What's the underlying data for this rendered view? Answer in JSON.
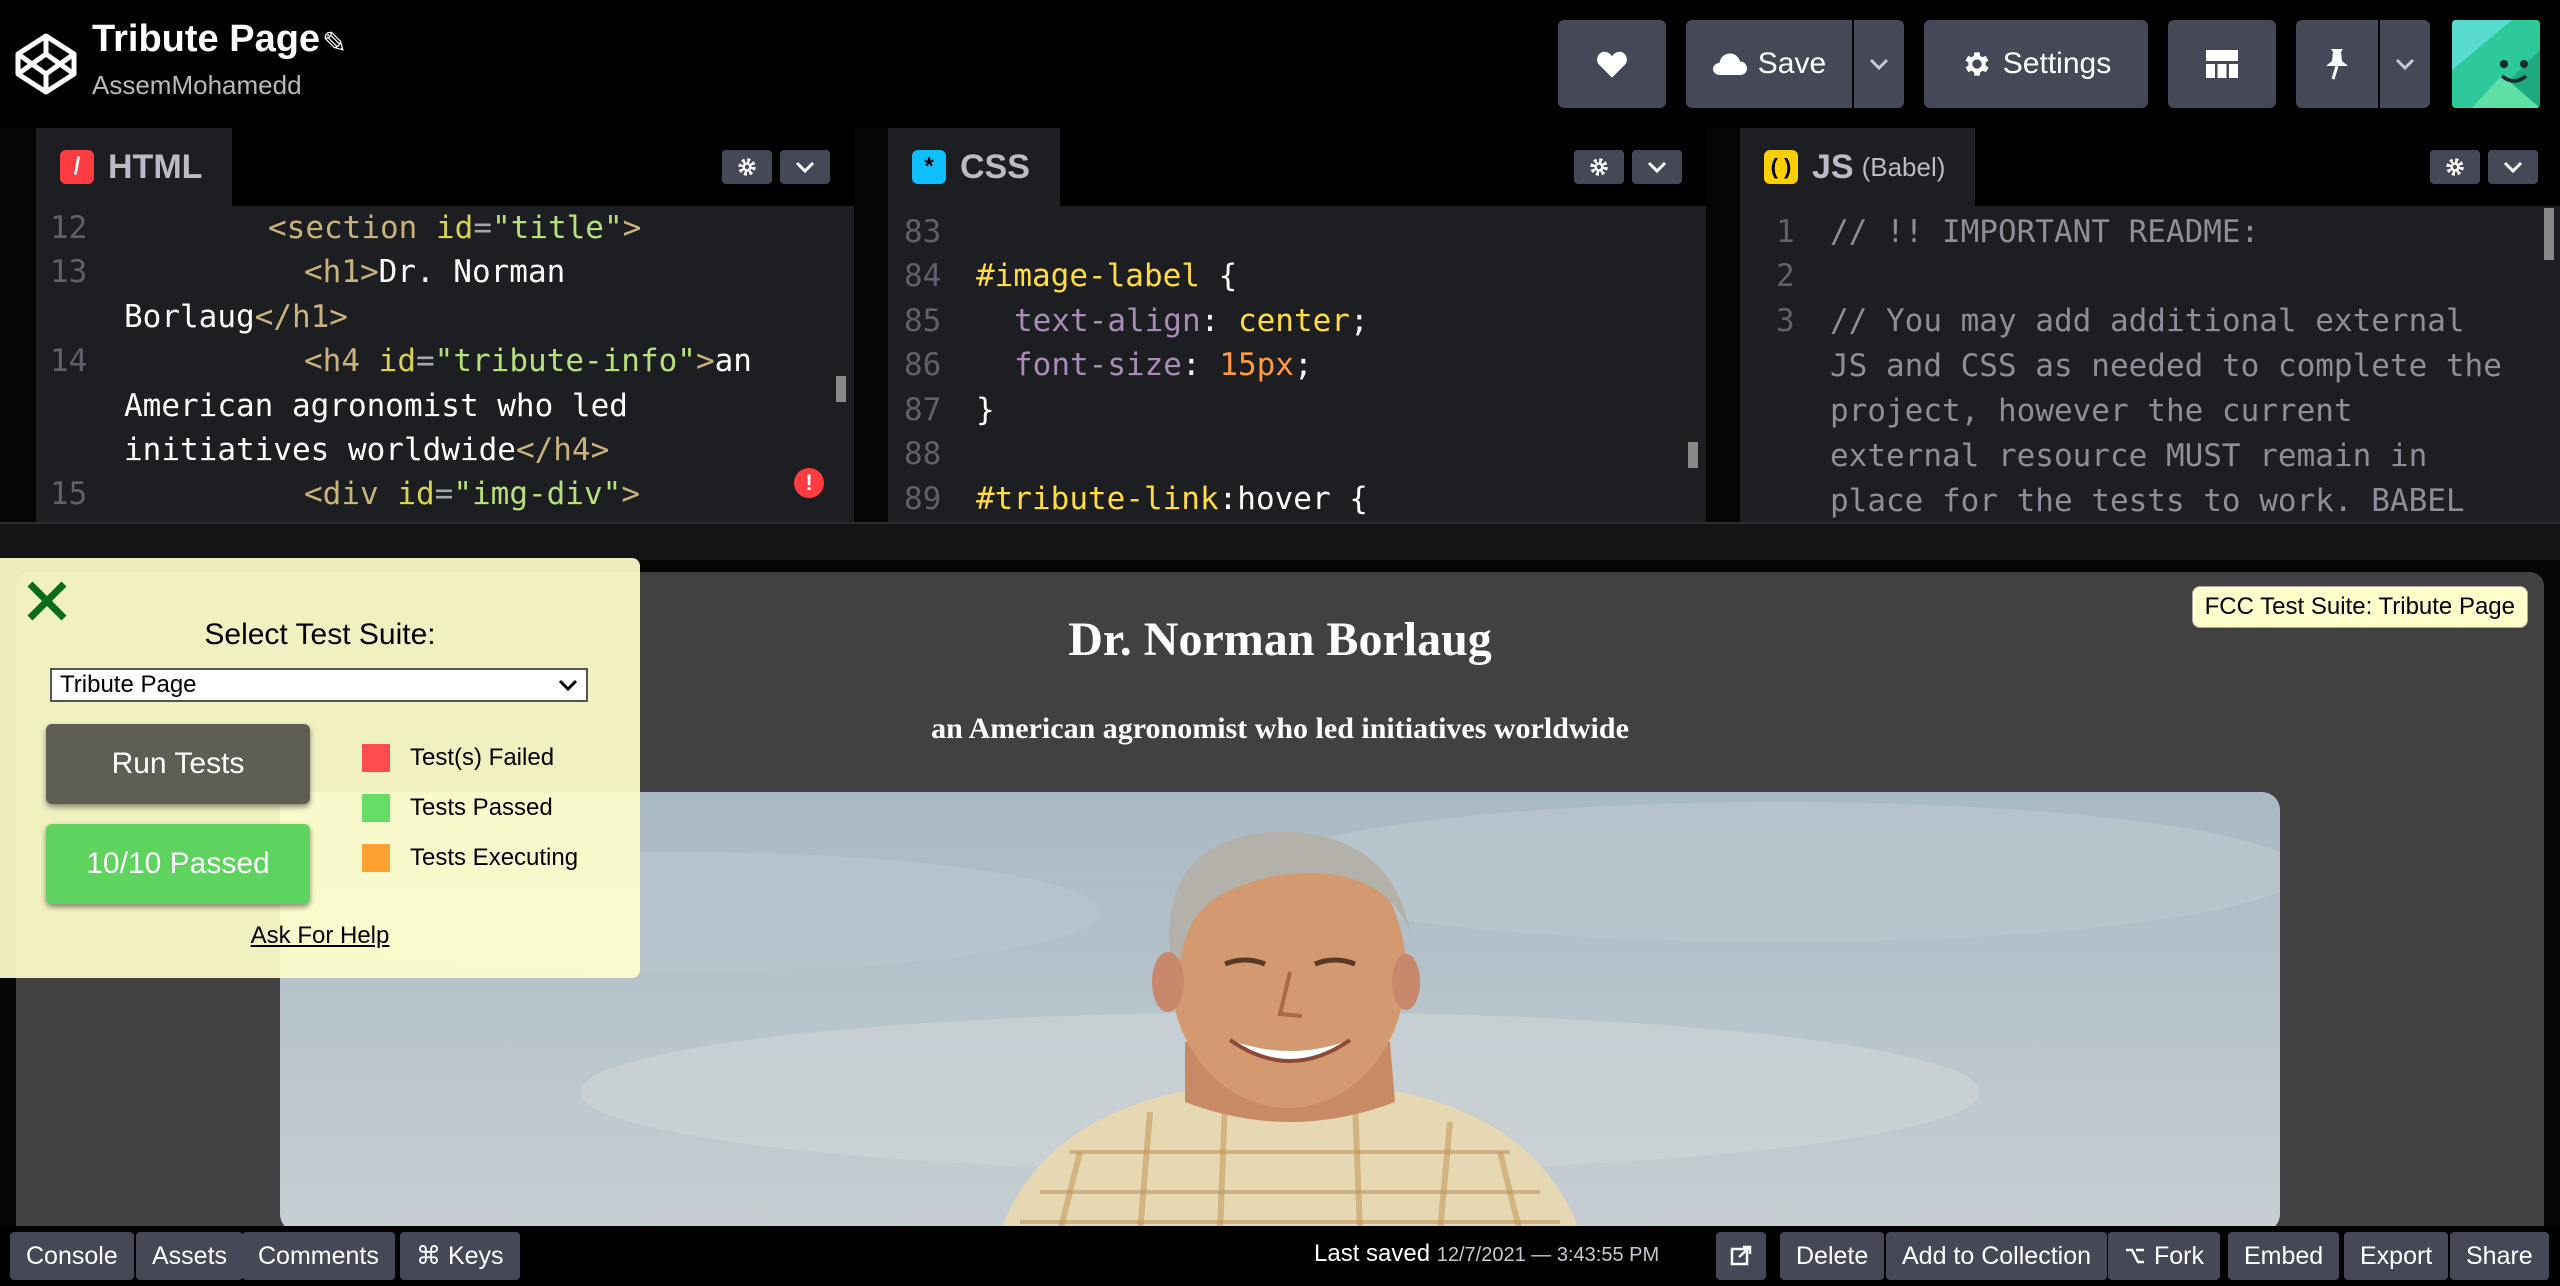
{
  "header": {
    "title": "Tribute Page",
    "owner": "AssemMohamedd",
    "save_label": "Save",
    "settings_label": "Settings"
  },
  "editors": {
    "html": {
      "label": "HTML",
      "lines": [
        {
          "num": "12",
          "text": "<section id=\"title\">"
        },
        {
          "num": "13",
          "text": "<h1>Dr. Norman Borlaug</h1>"
        },
        {
          "num": "14",
          "text": "<h4 id=\"tribute-info\">an American agronomist who led initiatives worldwide</h4>"
        },
        {
          "num": "15",
          "text": "<div id=\"img-div\">"
        }
      ]
    },
    "css": {
      "label": "CSS",
      "lines": [
        {
          "num": "83",
          "text": ""
        },
        {
          "num": "84",
          "text": "#image-label {"
        },
        {
          "num": "85",
          "text": "text-align: center;"
        },
        {
          "num": "86",
          "text": "font-size: 15px;"
        },
        {
          "num": "87",
          "text": "}"
        },
        {
          "num": "88",
          "text": ""
        },
        {
          "num": "89",
          "text": "#tribute-link:hover {"
        }
      ]
    },
    "js": {
      "label": "JS",
      "sublabel": "(Babel)",
      "lines": [
        {
          "num": "1",
          "text": "// !! IMPORTANT README:"
        },
        {
          "num": "2",
          "text": ""
        },
        {
          "num": "3",
          "text": "// You may add additional external JS and CSS as needed to complete the project, however the current external resource MUST remain in place for the tests to work. BABEL"
        }
      ]
    }
  },
  "preview": {
    "heading": "Dr. Norman Borlaug",
    "subheading": "an American agronomist who led initiatives worldwide",
    "badge": "FCC Test Suite: Tribute Page"
  },
  "test_panel": {
    "select_label": "Select Test Suite:",
    "selected_suite": "Tribute Page",
    "run_label": "Run Tests",
    "result_label": "10/10 Passed",
    "help_label": "Ask For Help",
    "legend": [
      {
        "label": "Test(s) Failed",
        "color": "#ff4c4c"
      },
      {
        "label": "Tests Passed",
        "color": "#66dd66"
      },
      {
        "label": "Tests Executing",
        "color": "#ffa033"
      }
    ]
  },
  "footer": {
    "console": "Console",
    "assets": "Assets",
    "comments": "Comments",
    "keys": "⌘ Keys",
    "last_saved_label": "Last saved",
    "last_saved_value": "12/7/2021 — 3:43:55 PM",
    "delete": "Delete",
    "add_to_collection": "Add to Collection",
    "fork": "Fork",
    "embed": "Embed",
    "export": "Export",
    "share": "Share"
  },
  "colors": {
    "html_icon": "#ff3c41",
    "css_icon": "#0ebeff",
    "js_icon": "#fcd000",
    "pass_green": "#5fd35f",
    "run_gray": "#5e5e54"
  }
}
